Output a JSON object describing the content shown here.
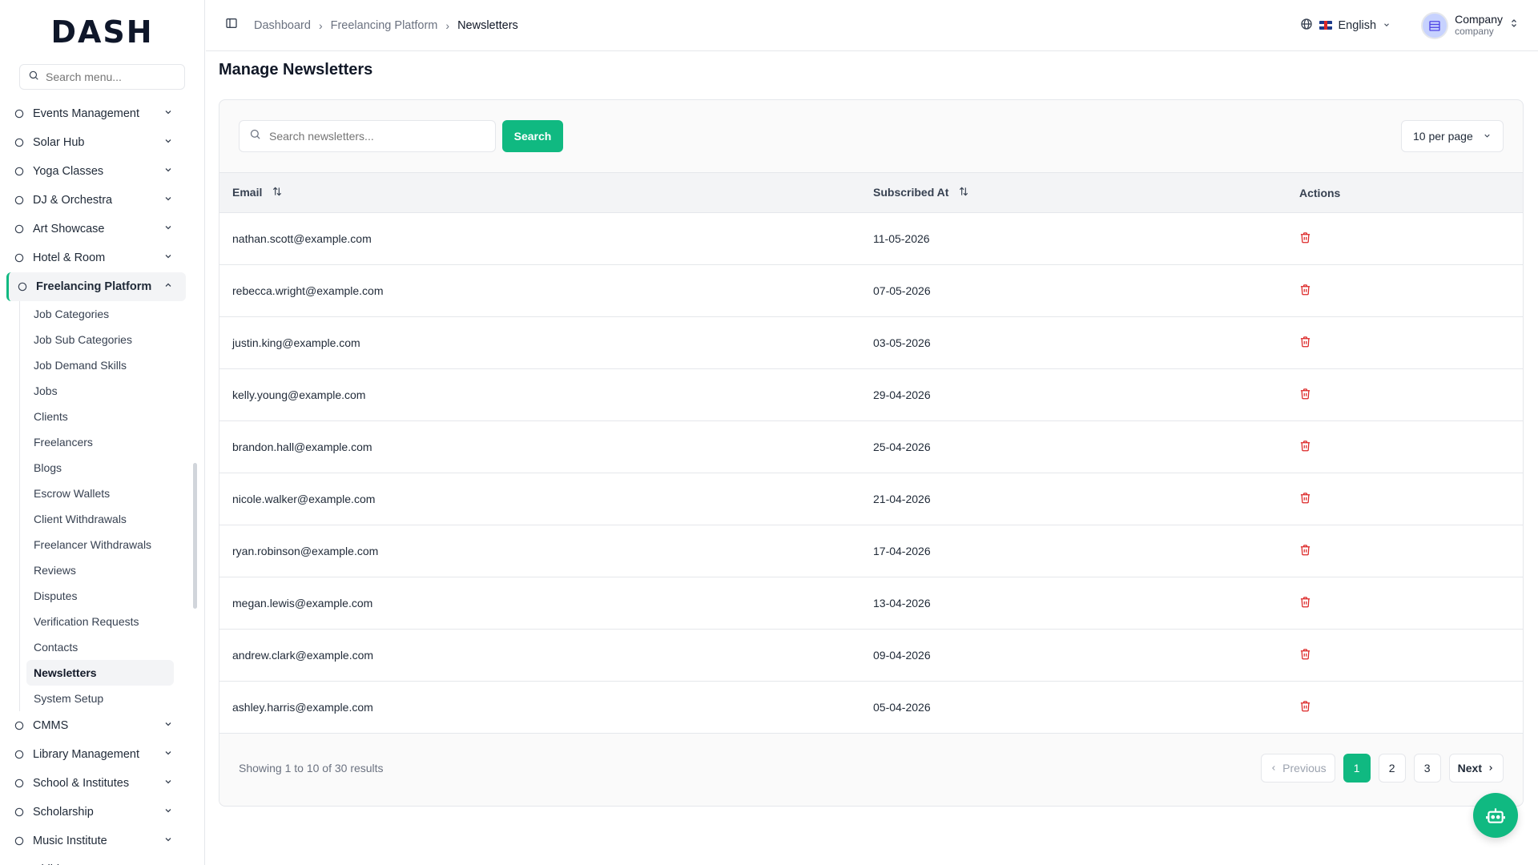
{
  "brand": {
    "logo_text": "DASH"
  },
  "sidebar": {
    "search_placeholder": "Search menu...",
    "items_top": [
      {
        "label": "Events Management",
        "icon": "events-icon"
      },
      {
        "label": "Solar Hub",
        "icon": "bolt-icon"
      },
      {
        "label": "Yoga Classes",
        "icon": "sun-icon"
      },
      {
        "label": "DJ & Orchestra",
        "icon": "disc-icon"
      },
      {
        "label": "Art Showcase",
        "icon": "palette-icon"
      },
      {
        "label": "Hotel & Room",
        "icon": "concierge-icon"
      }
    ],
    "active_group": {
      "label": "Freelancing Platform",
      "icon": "laptop-icon"
    },
    "sub_items": [
      "Job Categories",
      "Job Sub Categories",
      "Job Demand Skills",
      "Jobs",
      "Clients",
      "Freelancers",
      "Blogs",
      "Escrow Wallets",
      "Client Withdrawals",
      "Freelancer Withdrawals",
      "Reviews",
      "Disputes",
      "Verification Requests",
      "Contacts",
      "Newsletters",
      "System Setup"
    ],
    "current_sub": "Newsletters",
    "items_bottom": [
      {
        "label": "CMMS",
        "icon": "cog-icon"
      },
      {
        "label": "Library Management",
        "icon": "library-icon"
      },
      {
        "label": "School & Institutes",
        "icon": "building-icon"
      },
      {
        "label": "Scholarship",
        "icon": "book-icon"
      },
      {
        "label": "Music Institute",
        "icon": "music-icon"
      },
      {
        "label": "Childcare",
        "icon": "child-icon"
      }
    ]
  },
  "header": {
    "breadcrumb": [
      "Dashboard",
      "Freelancing Platform",
      "Newsletters"
    ],
    "language": "English",
    "user_name": "Company",
    "user_role": "company"
  },
  "main": {
    "title": "Manage Newsletters",
    "search_placeholder": "Search newsletters...",
    "search_button": "Search",
    "per_page": "10 per page",
    "columns": {
      "email": "Email",
      "subscribed_at": "Subscribed At",
      "actions": "Actions"
    },
    "rows": [
      {
        "email": "nathan.scott@example.com",
        "subscribed_at": "11-05-2026"
      },
      {
        "email": "rebecca.wright@example.com",
        "subscribed_at": "07-05-2026"
      },
      {
        "email": "justin.king@example.com",
        "subscribed_at": "03-05-2026"
      },
      {
        "email": "kelly.young@example.com",
        "subscribed_at": "29-04-2026"
      },
      {
        "email": "brandon.hall@example.com",
        "subscribed_at": "25-04-2026"
      },
      {
        "email": "nicole.walker@example.com",
        "subscribed_at": "21-04-2026"
      },
      {
        "email": "ryan.robinson@example.com",
        "subscribed_at": "17-04-2026"
      },
      {
        "email": "megan.lewis@example.com",
        "subscribed_at": "13-04-2026"
      },
      {
        "email": "andrew.clark@example.com",
        "subscribed_at": "09-04-2026"
      },
      {
        "email": "ashley.harris@example.com",
        "subscribed_at": "05-04-2026"
      }
    ],
    "showing": "Showing 1 to 10 of 30 results",
    "pagination": {
      "previous": "Previous",
      "pages": [
        "1",
        "2",
        "3"
      ],
      "current": "1",
      "next": "Next"
    }
  },
  "colors": {
    "accent": "#10b981",
    "danger": "#dc2626"
  }
}
